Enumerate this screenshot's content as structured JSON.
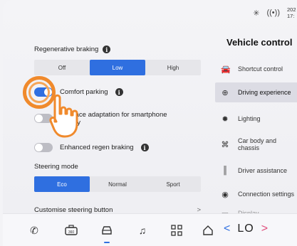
{
  "status": {
    "clock": "202\n17:"
  },
  "regen": {
    "title": "Regenerative braking",
    "options": [
      "Off",
      "Low",
      "High"
    ],
    "selected": "Low"
  },
  "comfort_parking": {
    "label": "Comfort parking",
    "on": true
  },
  "interface_adaptation": {
    "label_line1": "Interface adaptation for smartphone",
    "label_line2": "activity"
  },
  "enhanced_regen": {
    "label": "Enhanced regen braking",
    "on": false
  },
  "steering": {
    "title": "Steering mode",
    "options": [
      "Eco",
      "Normal",
      "Sport"
    ],
    "selected": "Eco"
  },
  "customise": {
    "label": "Customise steering button",
    "chevron": ">"
  },
  "sidebar": {
    "title": "Vehicle control",
    "items": [
      {
        "label": "Shortcut control",
        "icon": "car-icon"
      },
      {
        "label": "Driving experience",
        "icon": "steering-wheel-icon",
        "active": true
      },
      {
        "label": "Lighting",
        "icon": "light-icon"
      },
      {
        "label": "Car body and chassis",
        "icon": "chassis-icon"
      },
      {
        "label": "Driver assistance",
        "icon": "assist-icon"
      },
      {
        "label": "Connection settings",
        "icon": "connection-icon"
      },
      {
        "label": "Display",
        "icon": "display-icon"
      }
    ]
  },
  "bottombar": {
    "lo_label": "LO",
    "prev": "<",
    "next": ">"
  },
  "colors": {
    "accent": "#2f6fe0",
    "tap": "#f08a2c"
  }
}
